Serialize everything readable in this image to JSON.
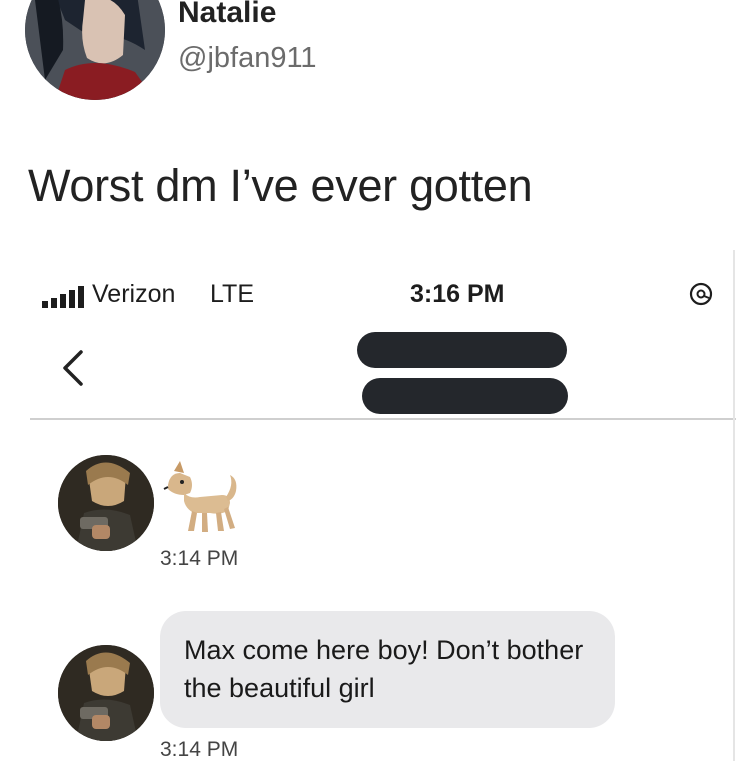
{
  "tweet": {
    "display_name": "Natalie",
    "handle": "@jbfan911",
    "text": "Worst dm I’ve ever gotten"
  },
  "phone": {
    "status_bar": {
      "carrier": "Verizon",
      "network": "LTE",
      "time": "3:16 PM",
      "signal_icon": "signal-bars-icon",
      "status_icon": "orientation-lock-icon"
    },
    "nav": {
      "back_icon": "chevron-left-icon"
    },
    "messages": [
      {
        "kind": "emoji",
        "emoji_icon": "dog-emoji",
        "timestamp": "3:14 PM"
      },
      {
        "kind": "text",
        "text": "Max come here boy! Don’t bother the beautiful girl",
        "timestamp": "3:14 PM"
      }
    ]
  },
  "colors": {
    "bubble": "#e9e9eb",
    "redaction": "#24272c",
    "handle": "#6b6b6b"
  }
}
